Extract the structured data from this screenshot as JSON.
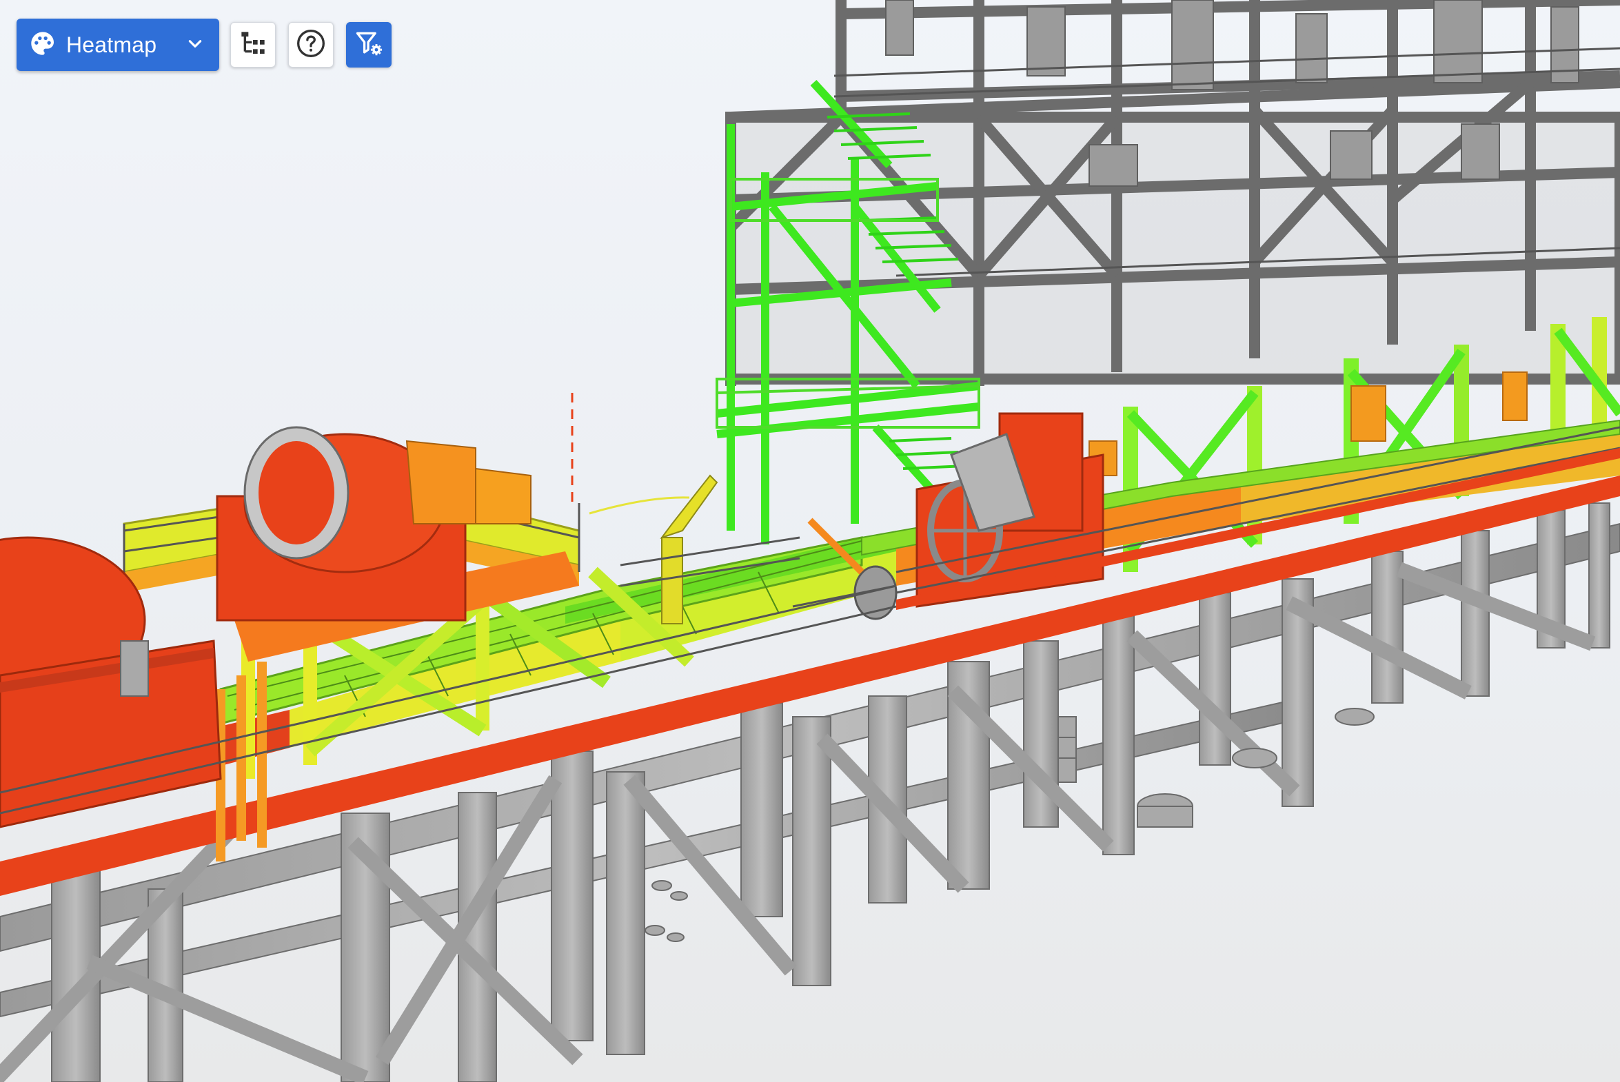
{
  "toolbar": {
    "mode_dropdown": {
      "label": "Heatmap",
      "icon": "palette-icon",
      "caret": "chevron-down-icon"
    },
    "buttons": [
      {
        "name": "tree-view-button",
        "icon": "hierarchy-tree-icon"
      },
      {
        "name": "help-button",
        "icon": "question-circle-icon"
      },
      {
        "name": "filter-settings-button",
        "icon": "filter-gear-icon",
        "active": true
      }
    ]
  },
  "colors": {
    "accent": "#2f6fd8",
    "heat_high": "#e8421a",
    "heat_mid_high": "#f5891e",
    "heat_mid": "#e7ef2c",
    "heat_low": "#7cec2a",
    "heat_lowest": "#3df21d",
    "structure_neutral": "#8c8c8c",
    "background": "#eef1f5"
  }
}
